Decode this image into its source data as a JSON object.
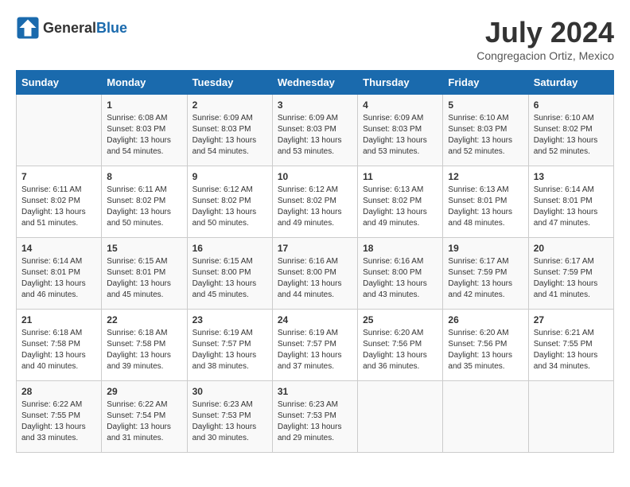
{
  "header": {
    "logo_general": "General",
    "logo_blue": "Blue",
    "month_year": "July 2024",
    "location": "Congregacion Ortiz, Mexico"
  },
  "days_of_week": [
    "Sunday",
    "Monday",
    "Tuesday",
    "Wednesday",
    "Thursday",
    "Friday",
    "Saturday"
  ],
  "weeks": [
    [
      {
        "day": "",
        "sunrise": "",
        "sunset": "",
        "daylight": ""
      },
      {
        "day": "1",
        "sunrise": "6:08 AM",
        "sunset": "8:03 PM",
        "daylight": "13 hours and 54 minutes."
      },
      {
        "day": "2",
        "sunrise": "6:09 AM",
        "sunset": "8:03 PM",
        "daylight": "13 hours and 54 minutes."
      },
      {
        "day": "3",
        "sunrise": "6:09 AM",
        "sunset": "8:03 PM",
        "daylight": "13 hours and 53 minutes."
      },
      {
        "day": "4",
        "sunrise": "6:09 AM",
        "sunset": "8:03 PM",
        "daylight": "13 hours and 53 minutes."
      },
      {
        "day": "5",
        "sunrise": "6:10 AM",
        "sunset": "8:03 PM",
        "daylight": "13 hours and 52 minutes."
      },
      {
        "day": "6",
        "sunrise": "6:10 AM",
        "sunset": "8:02 PM",
        "daylight": "13 hours and 52 minutes."
      }
    ],
    [
      {
        "day": "7",
        "sunrise": "6:11 AM",
        "sunset": "8:02 PM",
        "daylight": "13 hours and 51 minutes."
      },
      {
        "day": "8",
        "sunrise": "6:11 AM",
        "sunset": "8:02 PM",
        "daylight": "13 hours and 50 minutes."
      },
      {
        "day": "9",
        "sunrise": "6:12 AM",
        "sunset": "8:02 PM",
        "daylight": "13 hours and 50 minutes."
      },
      {
        "day": "10",
        "sunrise": "6:12 AM",
        "sunset": "8:02 PM",
        "daylight": "13 hours and 49 minutes."
      },
      {
        "day": "11",
        "sunrise": "6:13 AM",
        "sunset": "8:02 PM",
        "daylight": "13 hours and 49 minutes."
      },
      {
        "day": "12",
        "sunrise": "6:13 AM",
        "sunset": "8:01 PM",
        "daylight": "13 hours and 48 minutes."
      },
      {
        "day": "13",
        "sunrise": "6:14 AM",
        "sunset": "8:01 PM",
        "daylight": "13 hours and 47 minutes."
      }
    ],
    [
      {
        "day": "14",
        "sunrise": "6:14 AM",
        "sunset": "8:01 PM",
        "daylight": "13 hours and 46 minutes."
      },
      {
        "day": "15",
        "sunrise": "6:15 AM",
        "sunset": "8:01 PM",
        "daylight": "13 hours and 45 minutes."
      },
      {
        "day": "16",
        "sunrise": "6:15 AM",
        "sunset": "8:00 PM",
        "daylight": "13 hours and 45 minutes."
      },
      {
        "day": "17",
        "sunrise": "6:16 AM",
        "sunset": "8:00 PM",
        "daylight": "13 hours and 44 minutes."
      },
      {
        "day": "18",
        "sunrise": "6:16 AM",
        "sunset": "8:00 PM",
        "daylight": "13 hours and 43 minutes."
      },
      {
        "day": "19",
        "sunrise": "6:17 AM",
        "sunset": "7:59 PM",
        "daylight": "13 hours and 42 minutes."
      },
      {
        "day": "20",
        "sunrise": "6:17 AM",
        "sunset": "7:59 PM",
        "daylight": "13 hours and 41 minutes."
      }
    ],
    [
      {
        "day": "21",
        "sunrise": "6:18 AM",
        "sunset": "7:58 PM",
        "daylight": "13 hours and 40 minutes."
      },
      {
        "day": "22",
        "sunrise": "6:18 AM",
        "sunset": "7:58 PM",
        "daylight": "13 hours and 39 minutes."
      },
      {
        "day": "23",
        "sunrise": "6:19 AM",
        "sunset": "7:57 PM",
        "daylight": "13 hours and 38 minutes."
      },
      {
        "day": "24",
        "sunrise": "6:19 AM",
        "sunset": "7:57 PM",
        "daylight": "13 hours and 37 minutes."
      },
      {
        "day": "25",
        "sunrise": "6:20 AM",
        "sunset": "7:56 PM",
        "daylight": "13 hours and 36 minutes."
      },
      {
        "day": "26",
        "sunrise": "6:20 AM",
        "sunset": "7:56 PM",
        "daylight": "13 hours and 35 minutes."
      },
      {
        "day": "27",
        "sunrise": "6:21 AM",
        "sunset": "7:55 PM",
        "daylight": "13 hours and 34 minutes."
      }
    ],
    [
      {
        "day": "28",
        "sunrise": "6:22 AM",
        "sunset": "7:55 PM",
        "daylight": "13 hours and 33 minutes."
      },
      {
        "day": "29",
        "sunrise": "6:22 AM",
        "sunset": "7:54 PM",
        "daylight": "13 hours and 31 minutes."
      },
      {
        "day": "30",
        "sunrise": "6:23 AM",
        "sunset": "7:53 PM",
        "daylight": "13 hours and 30 minutes."
      },
      {
        "day": "31",
        "sunrise": "6:23 AM",
        "sunset": "7:53 PM",
        "daylight": "13 hours and 29 minutes."
      },
      {
        "day": "",
        "sunrise": "",
        "sunset": "",
        "daylight": ""
      },
      {
        "day": "",
        "sunrise": "",
        "sunset": "",
        "daylight": ""
      },
      {
        "day": "",
        "sunrise": "",
        "sunset": "",
        "daylight": ""
      }
    ]
  ]
}
